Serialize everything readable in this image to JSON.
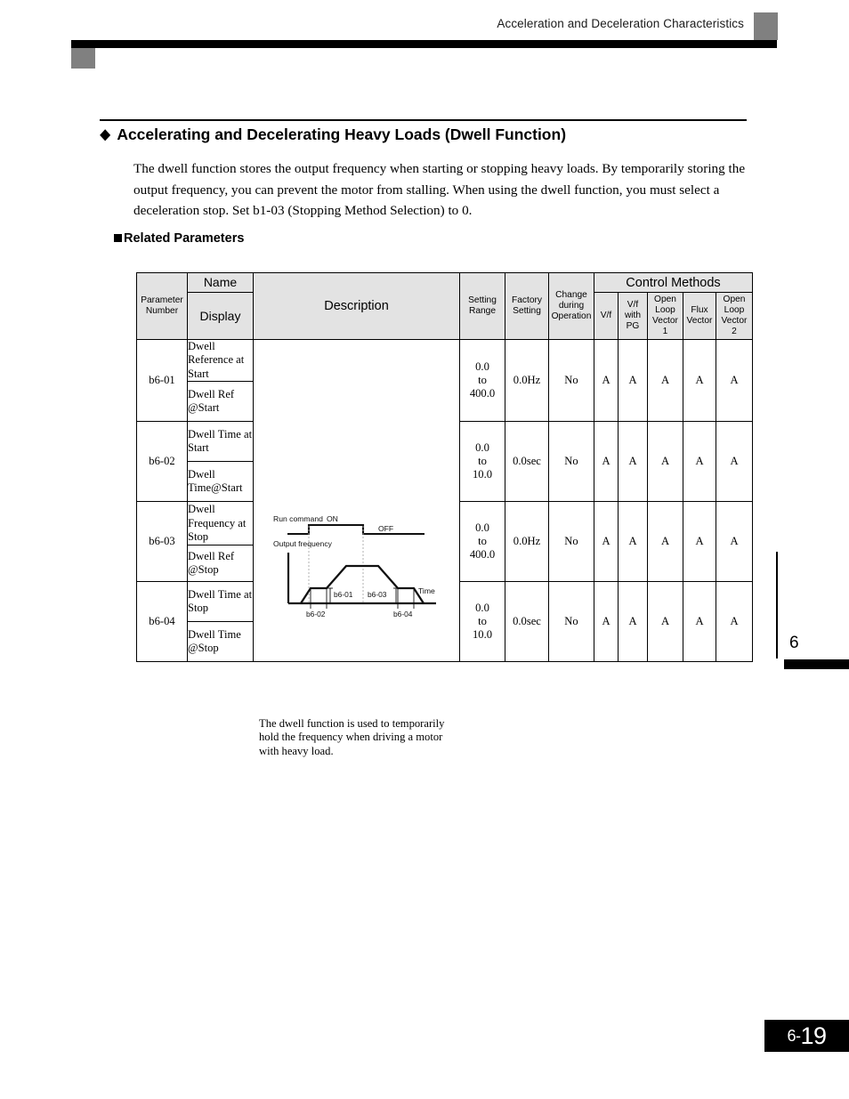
{
  "header": {
    "running_title": "Acceleration and Deceleration Characteristics"
  },
  "section": {
    "bullet": "◆",
    "title": "Accelerating and Decelerating Heavy Loads (Dwell Function)",
    "paragraph": "The dwell function stores the output frequency when starting or stopping heavy loads. By temporarily storing the output frequency, you can prevent the motor from stalling. When using the dwell function, you must select a deceleration stop. Set b1-03 (Stopping Method Selection) to 0.",
    "sub_heading": "Related Parameters"
  },
  "table": {
    "headers": {
      "parameter_number": "Parameter\nNumber",
      "name": "Name",
      "display": "Display",
      "description": "Description",
      "setting_range": "Setting\nRange",
      "factory_setting": "Factory\nSetting",
      "change_during_operation": "Change\nduring\nOperation",
      "control_methods": "Control Methods",
      "cm_vf": "V/f",
      "cm_vf_pg": "V/f\nwith\nPG",
      "cm_olv1": "Open\nLoop\nVector\n1",
      "cm_flux": "Flux\nVector",
      "cm_olv2": "Open\nLoop\nVector\n2"
    },
    "rows": [
      {
        "number": "b6-01",
        "name": "Dwell Reference at Start",
        "display": "Dwell Ref @Start",
        "setting_range": "0.0\nto\n400.0",
        "factory_setting": "0.0Hz",
        "change": "No",
        "vf": "A",
        "vf_pg": "A",
        "olv1": "A",
        "flux": "A",
        "olv2": "A"
      },
      {
        "number": "b6-02",
        "name": "Dwell Time at Start",
        "display": "Dwell Time@Start",
        "setting_range": "0.0\nto\n10.0",
        "factory_setting": "0.0sec",
        "change": "No",
        "vf": "A",
        "vf_pg": "A",
        "olv1": "A",
        "flux": "A",
        "olv2": "A"
      },
      {
        "number": "b6-03",
        "name": "Dwell Frequency at Stop",
        "display": "Dwell Ref @Stop",
        "setting_range": "0.0\nto\n400.0",
        "factory_setting": "0.0Hz",
        "change": "No",
        "vf": "A",
        "vf_pg": "A",
        "olv1": "A",
        "flux": "A",
        "olv2": "A"
      },
      {
        "number": "b6-04",
        "name": "Dwell Time at Stop",
        "display": "Dwell Time @Stop",
        "setting_range": "0.0\nto\n10.0",
        "factory_setting": "0.0sec",
        "change": "No",
        "vf": "A",
        "vf_pg": "A",
        "olv1": "A",
        "flux": "A",
        "olv2": "A"
      }
    ],
    "description_cell": {
      "text": "The dwell function is used to temporarily hold the frequency when driving a motor with heavy load.",
      "diagram": {
        "run_command_label": "Run command",
        "on_label": "ON",
        "off_label": "OFF",
        "output_frequency_label": "Output frequency",
        "time_label": "Time",
        "label_b6_01": "b6-01",
        "label_b6_02": "b6-02",
        "label_b6_03": "b6-03",
        "label_b6_04": "b6-04"
      }
    }
  },
  "chapter_tab": {
    "number": "6"
  },
  "page_number": {
    "chapter": "6-",
    "page": "19"
  }
}
